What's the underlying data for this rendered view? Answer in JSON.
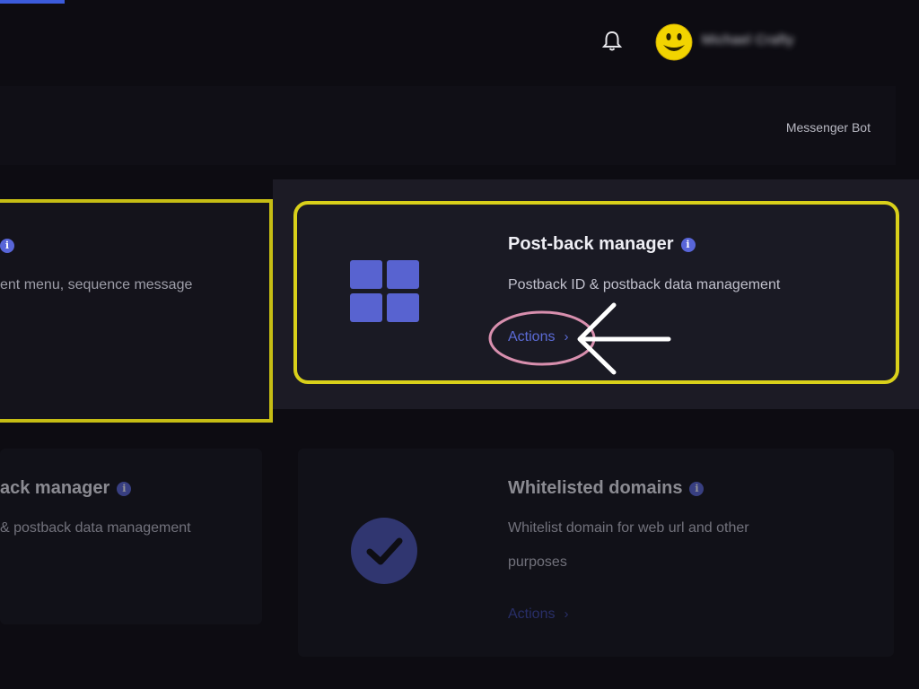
{
  "topbar": {
    "username": "Michael Crafty",
    "bell_icon": "bell-icon",
    "avatar_icon": "smiley-avatar"
  },
  "breadcrumb": {
    "text": "Messenger Bot"
  },
  "cards": {
    "left_top": {
      "desc": "ent menu, sequence message"
    },
    "postback_focus": {
      "title": "Post-back manager",
      "desc": "Postback ID & postback data management",
      "actions": "Actions",
      "icon": "grid-icon"
    },
    "postback_bottom": {
      "title": "ack manager",
      "desc": "& postback data management"
    },
    "whitelist": {
      "title": "Whitelisted domains",
      "desc_line1": "Whitelist domain for web url and other",
      "desc_line2": "purposes",
      "actions": "Actions",
      "icon": "check-circle-icon"
    }
  },
  "colors": {
    "accent": "#5865d8",
    "highlight_frame": "#d9d01a",
    "circle_annotation": "#d88fae",
    "background": "#0d0c12"
  }
}
